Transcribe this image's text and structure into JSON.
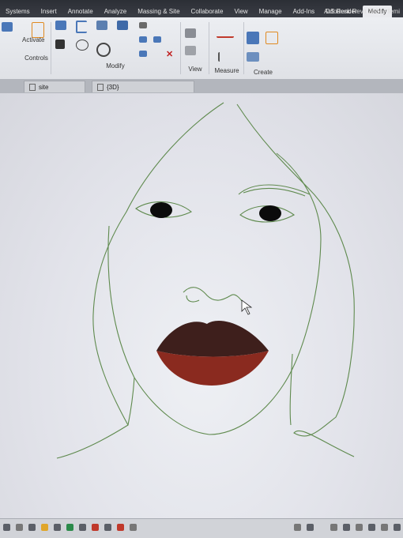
{
  "menu": {
    "tabs": [
      "Systems",
      "Insert",
      "Annotate",
      "Analyze",
      "Massing & Site",
      "Collaborate",
      "View",
      "Manage",
      "Add-Ins",
      "DS Render",
      "Modify"
    ],
    "active_tab": "Modify"
  },
  "app_title": "Autodesk Revit 2024 - femi",
  "ribbon": {
    "activate_label": "Activate",
    "controls_label": "Controls",
    "modify_label": "Modify",
    "view_label": "View",
    "measure_label": "Measure",
    "create_label": "Create"
  },
  "view_tabs": [
    {
      "label": "site"
    },
    {
      "label": "{3D}"
    }
  ],
  "colors": {
    "line": "#5f8a4e",
    "lip_upper": "#3e1f1c",
    "lip_lower": "#8a2a1f",
    "pupil": "#0b0b0b"
  }
}
